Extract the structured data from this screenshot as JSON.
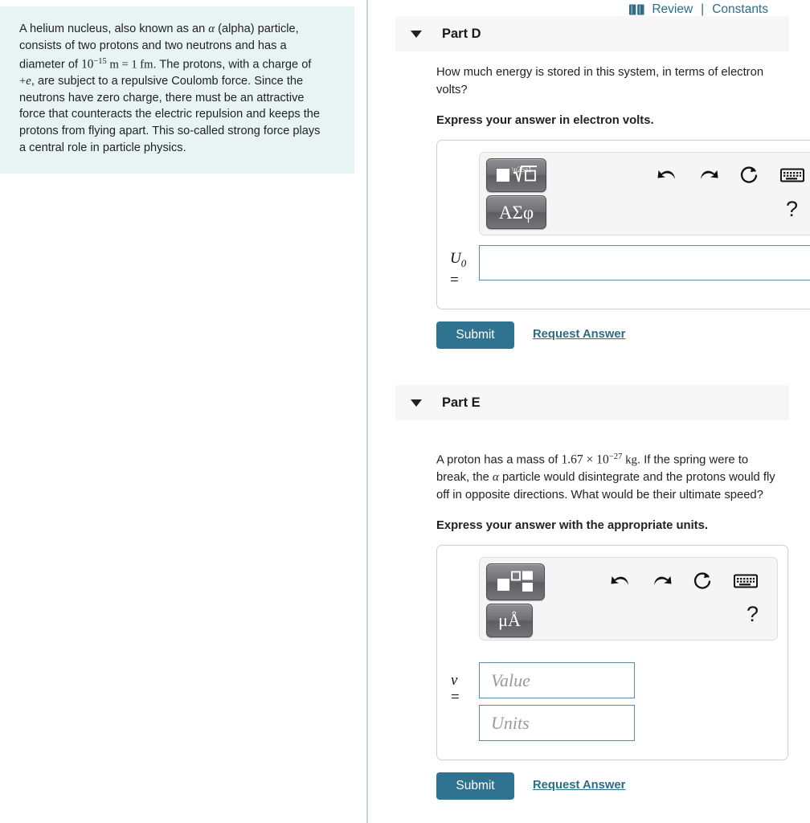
{
  "intro": {
    "segments": [
      {
        "t": "text",
        "v": "A helium nucleus, also known as an "
      },
      {
        "t": "mathit",
        "v": "α"
      },
      {
        "t": "text",
        "v": " (alpha) particle, consists of two protons and two neutrons and has a diameter of "
      },
      {
        "t": "mathnum",
        "v": "10"
      },
      {
        "t": "sup",
        "v": "−15"
      },
      {
        "t": "mathrm",
        "v": " m = 1 fm"
      },
      {
        "t": "text",
        "v": ". The protons, with a charge of "
      },
      {
        "t": "mathrm",
        "v": "+"
      },
      {
        "t": "mathit",
        "v": "e"
      },
      {
        "t": "text",
        "v": ", are subject to a repulsive Coulomb force. Since the neutrons have zero charge, there must be an attractive force that counteracts the electric repulsion and keeps the protons from flying apart. This so-called strong force plays a central role in particle physics."
      }
    ],
    "plain": "A helium nucleus, also known as an α (alpha) particle, consists of two protons and two neutrons and has a diameter of 10⁻¹⁵ m = 1 fm. The protons, with a charge of +e, are subject to a repulsive Coulomb force. Since the neutrons have zero charge, there must be an attractive force that counteracts the electric repulsion and keeps the protons from flying apart. This so-called strong force plays a central role in particle physics.",
    "background_color": "#e8f4f4"
  },
  "header": {
    "book_icon": "book-icon",
    "review_label": "Review",
    "separator": "|",
    "constants_label": "Constants",
    "link_color": "#2b6d86"
  },
  "parts": [
    {
      "id": "part-d",
      "caret_icon": "caret-down-icon",
      "title": "Part D",
      "question_lines": [
        "How much energy is stored in this system, in terms of electron volts?"
      ],
      "instruction": "Express your answer in electron volts.",
      "toolbar": {
        "template_button": "square-root-template-icon",
        "symbol_button_label": "ΑΣφ",
        "undo_icon": "undo-icon",
        "redo_icon": "redo-icon",
        "reset_icon": "reset-icon",
        "keyboard_icon": "keyboard-icon",
        "help_label": "?"
      },
      "input": {
        "variable": "U",
        "subscript": "0",
        "equals": "=",
        "value": "",
        "placeholder": ""
      },
      "submit_label": "Submit",
      "request_answer_label": "Request Answer"
    },
    {
      "id": "part-e",
      "caret_icon": "caret-down-icon",
      "title": "Part E",
      "question_segments": [
        {
          "t": "text",
          "v": "A proton has a mass of "
        },
        {
          "t": "mathnum",
          "v": "1.67 × 10"
        },
        {
          "t": "sup",
          "v": "−27"
        },
        {
          "t": "mathrm",
          "v": " kg"
        },
        {
          "t": "text",
          "v": ". If the spring were to break, the "
        },
        {
          "t": "mathit",
          "v": "α"
        },
        {
          "t": "text",
          "v": " particle would disintegrate and the protons would fly off in opposite directions. What would be their ultimate speed?"
        }
      ],
      "question_plain": "A proton has a mass of 1.67 × 10⁻²⁷ kg. If the spring were to break, the α particle would disintegrate and the protons would fly off in opposite directions. What would be their ultimate speed?",
      "instruction": "Express your answer with the appropriate units.",
      "toolbar": {
        "template_button": "superscript-fraction-template-icon",
        "symbol_button_label": "μÅ",
        "undo_icon": "undo-icon",
        "redo_icon": "redo-icon",
        "reset_icon": "reset-icon",
        "keyboard_icon": "keyboard-icon",
        "help_label": "?"
      },
      "input": {
        "variable": "v",
        "equals": "=",
        "value_field_placeholder": "Value",
        "value_field_value": "",
        "units_field_placeholder": "Units",
        "units_field_value": ""
      },
      "submit_label": "Submit",
      "request_answer_label": "Request Answer"
    }
  ],
  "colors": {
    "submit_button": "#2f7391",
    "link": "#2b6d86",
    "part_header_bg": "#f7f7f7",
    "intro_bg": "#e8f4f4",
    "input_border": "#5b89a6",
    "divider": "#c8d4dd"
  }
}
